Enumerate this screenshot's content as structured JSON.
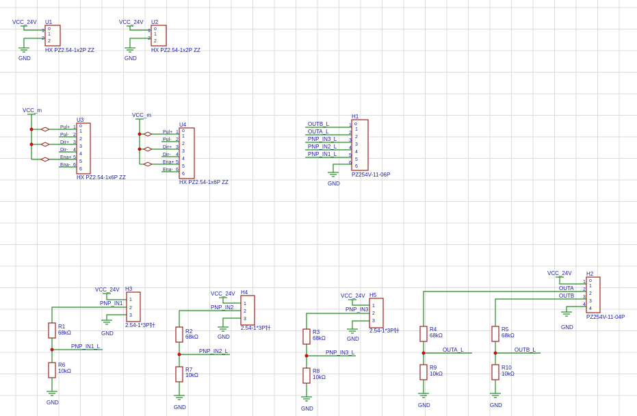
{
  "nets": {
    "vcc_24v": "VCC_24V",
    "vcc_m": "VCC_m",
    "gnd": "GND",
    "pnp_in1": "PNP_IN1",
    "pnp_in2": "PNP_IN2",
    "pnp_in3": "PNP_IN3",
    "pnp_in1_l": "PNP_IN1_L",
    "pnp_in2_l": "PNP_IN2_L",
    "pnp_in3_l": "PNP_IN3_L",
    "outa": "OUTA",
    "outb": "OUTB",
    "outa_l": "OUTA_L",
    "outb_l": "OUTB_L"
  },
  "components": {
    "u1": {
      "ref": "U1",
      "part": "HX PZ2.54-1x2P ZZ"
    },
    "u2": {
      "ref": "U2",
      "part": "HX PZ2.54-1x2P ZZ"
    },
    "u3": {
      "ref": "U3",
      "part": "HX PZ2.54-1x6P ZZ"
    },
    "u4": {
      "ref": "U4",
      "part": "HX PZ2.54-1x6P ZZ"
    },
    "h1": {
      "ref": "H1",
      "part": "PZ254V-11-06P"
    },
    "h2": {
      "ref": "H2",
      "part": "PZ254V-11-04P"
    },
    "h3": {
      "ref": "H3",
      "part": "2.54-1*3P针"
    },
    "h4": {
      "ref": "H4",
      "part": "2.54-1*3P针"
    },
    "h5": {
      "ref": "H5",
      "part": "2.54-1*3P针"
    }
  },
  "resistors": {
    "r1": {
      "ref": "R1",
      "value": "68kΩ"
    },
    "r2": {
      "ref": "R2",
      "value": "68kΩ"
    },
    "r3": {
      "ref": "R3",
      "value": "68kΩ"
    },
    "r4": {
      "ref": "R4",
      "value": "68kΩ"
    },
    "r5": {
      "ref": "R5",
      "value": "68kΩ"
    },
    "r6": {
      "ref": "R6",
      "value": "10kΩ"
    },
    "r7": {
      "ref": "R7",
      "value": "10kΩ"
    },
    "r8": {
      "ref": "R8",
      "value": "10kΩ"
    },
    "r9": {
      "ref": "R9",
      "value": "10kΩ"
    },
    "r10": {
      "ref": "R10",
      "value": "10kΩ"
    }
  },
  "h1_nets": [
    "OUTB_L",
    "OUTA_L",
    "PNP_IN3_L",
    "PNP_IN2_L",
    "PNP_IN1_L"
  ],
  "ctrl_pins": [
    "Pul+",
    "Pul-",
    "Dir+",
    "Dir-",
    "Ena+",
    "Ena-"
  ],
  "pin_numbers": [
    "1",
    "2",
    "3",
    "4",
    "5",
    "6"
  ],
  "colors": {
    "wire": "#1e8c1e",
    "component": "#9c1f1f",
    "label": "#1a1aa6",
    "junction": "#c41212",
    "grid": "#dcdcdc"
  }
}
